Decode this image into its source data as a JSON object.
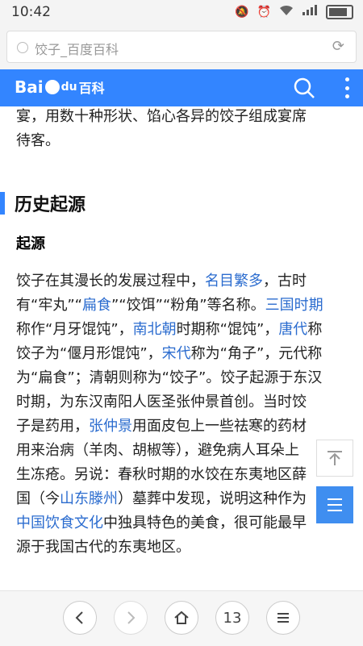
{
  "status": {
    "time": "10:42"
  },
  "address": {
    "title": "饺子_百度百科"
  },
  "app": {
    "logo_text_left": "Bai",
    "logo_text_right": "du",
    "logo_baike": "百科"
  },
  "content": {
    "intro_line1": "宴，用数十种形状、馅心各异的饺子组成宴席",
    "intro_line2": "待客。",
    "section_title": "历史起源",
    "subheading": "起源",
    "para_lines": [
      [
        "饺子在其漫长的发展过程中，",
        {
          "link": "名目繁多"
        },
        "，古时"
      ],
      [
        "有“牢丸”“",
        {
          "link": "扁食"
        },
        "”“饺饵”“粉角”等名称。",
        {
          "link": "三国时期"
        }
      ],
      [
        "称作“月牙馄饨”，",
        {
          "link": "南北朝"
        },
        "时期称“馄饨”，",
        {
          "link": "唐代"
        },
        "称"
      ],
      [
        "饺子为“偃月形馄饨”，",
        {
          "link": "宋代"
        },
        "称为“角子”，元代称"
      ],
      [
        "为“扁食”；清朝则称为“饺子”。饺子起源于东汉"
      ],
      [
        "时期，为东汉南阳人医圣张仲景首创。当时饺"
      ],
      [
        "子是药用，",
        {
          "link": "张仲景"
        },
        "用面皮包上一些祛寒的药材"
      ],
      [
        "用来治病（羊肉、胡椒等），避免病人耳朵上"
      ],
      [
        "生冻疮。另说：春秋时期的水饺在东夷地区薛"
      ],
      [
        "国（今",
        {
          "link": "山东滕州"
        },
        "）墓葬中发现，说明这种作为"
      ],
      [
        {
          "link": "中国饮食文化"
        },
        "中独具特色的美食，很可能最早"
      ],
      [
        "源于我国古代的东夷地区。"
      ]
    ]
  },
  "floating": {
    "top_icon": "arrow-up-icon",
    "menu_icon": "list-icon"
  },
  "bottom": {
    "page_count": "13"
  },
  "colors": {
    "appbar": "#3385ff",
    "link": "#2b6ccf"
  }
}
